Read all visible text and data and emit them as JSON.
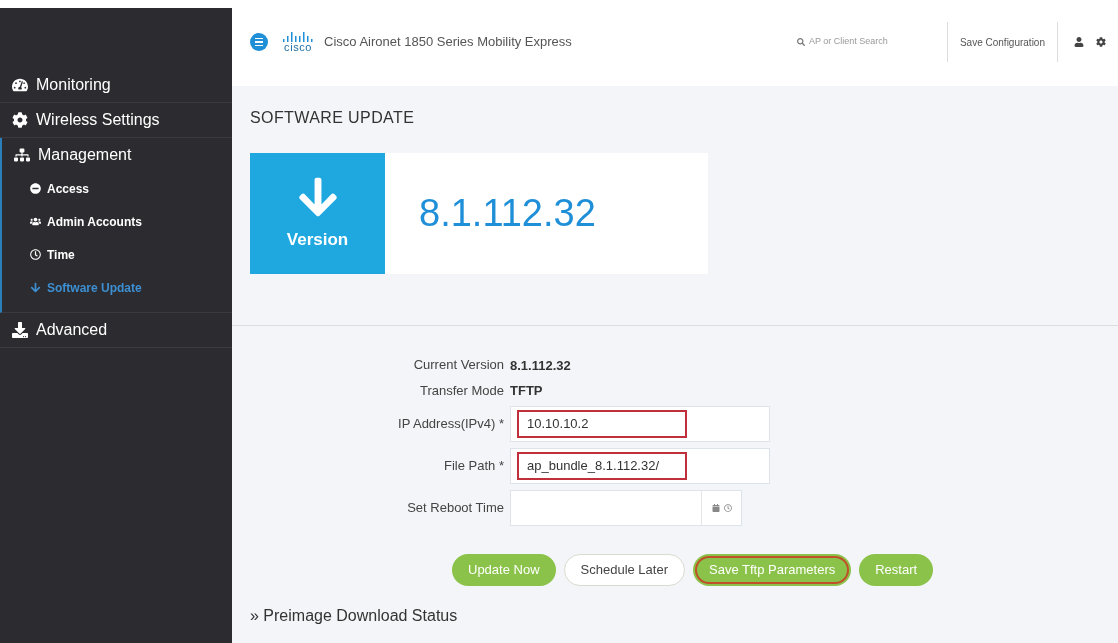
{
  "sidebar": {
    "items": [
      {
        "label": "Monitoring",
        "selected": false
      },
      {
        "label": "Wireless Settings",
        "selected": false
      },
      {
        "label": "Management",
        "selected": false,
        "expanded": true,
        "children": [
          {
            "label": "Access",
            "selected": false
          },
          {
            "label": "Admin Accounts",
            "selected": false
          },
          {
            "label": "Time",
            "selected": false
          },
          {
            "label": "Software Update",
            "selected": true
          }
        ]
      },
      {
        "label": "Advanced",
        "selected": false
      }
    ]
  },
  "header": {
    "brand": "cisco",
    "title": "Cisco Aironet 1850 Series Mobility Express",
    "search": {
      "placeholder": "AP or Client Search"
    },
    "save_button": "Save Configuration"
  },
  "page_title": "SOFTWARE UPDATE",
  "version_tile": {
    "label": "Version",
    "value": "8.1.112.32"
  },
  "form": {
    "rows": [
      {
        "kind": "text",
        "label": "Current Version",
        "value": "8.1.112.32"
      },
      {
        "kind": "text",
        "label": "Transfer Mode",
        "value": "TFTP"
      },
      {
        "kind": "input",
        "label": "IP Address(IPv4) *",
        "value": "10.10.10.2",
        "highlighted": true
      },
      {
        "kind": "input",
        "label": "File Path *",
        "value": "ap_bundle_8.1.112.32/",
        "highlighted": true
      },
      {
        "kind": "datetime",
        "label": "Set Reboot Time",
        "value": "",
        "highlighted": false
      }
    ]
  },
  "buttons": [
    {
      "label": "Update Now",
      "kind": "primary",
      "highlighted": false
    },
    {
      "label": "Schedule Later",
      "kind": "secondary",
      "highlighted": false
    },
    {
      "label": "Save Tftp Parameters",
      "kind": "primary",
      "highlighted": true
    },
    {
      "label": "Restart",
      "kind": "primary",
      "highlighted": false
    }
  ],
  "section_link": "» Preimage Download Status"
}
